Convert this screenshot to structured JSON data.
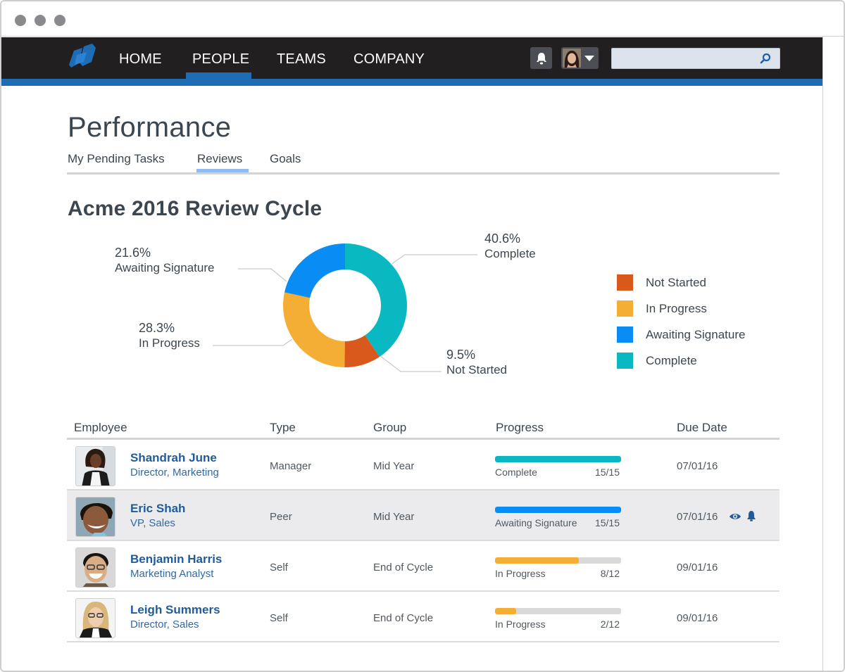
{
  "window": {
    "controls": [
      "close",
      "minimize",
      "maximize"
    ]
  },
  "navbar": {
    "logo": "company-logo",
    "items": [
      {
        "label": "HOME",
        "active": false
      },
      {
        "label": "PEOPLE",
        "active": true
      },
      {
        "label": "TEAMS",
        "active": false
      },
      {
        "label": "COMPANY",
        "active": false
      }
    ],
    "notifications_icon": "bell-icon",
    "user_menu_icon": "chevron-down-icon",
    "search": {
      "value": "",
      "placeholder": "",
      "icon": "search-icon"
    }
  },
  "page": {
    "title": "Performance",
    "tabs": [
      {
        "label": "My Pending Tasks",
        "active": false
      },
      {
        "label": "Reviews",
        "active": true
      },
      {
        "label": "Goals",
        "active": false
      }
    ],
    "section_title": "Acme 2016 Review Cycle"
  },
  "colors": {
    "not_started": "#d9581c",
    "in_progress": "#f5ae35",
    "awaiting_signature": "#0a8cf5",
    "complete": "#0ab8c2",
    "nav_bg": "#221f20",
    "brand_blue": "#1e6db4",
    "link": "#1f5c99"
  },
  "chart_data": {
    "type": "pie",
    "variant": "donut",
    "title": "Acme 2016 Review Cycle",
    "categories": [
      "Complete",
      "Not Started",
      "In Progress",
      "Awaiting Signature"
    ],
    "values": [
      40.6,
      9.5,
      28.3,
      21.6
    ],
    "unit": "%",
    "data_labels": [
      "40.6%",
      "9.5%",
      "28.3%",
      "21.6%"
    ],
    "colors": [
      "#0ab8c2",
      "#d9581c",
      "#f5ae35",
      "#0a8cf5"
    ],
    "start_angle": "12 o'clock",
    "direction": "clockwise",
    "legend": {
      "placement": "right",
      "entries": [
        {
          "label": "Not Started",
          "color": "#d9581c"
        },
        {
          "label": "In Progress",
          "color": "#f5ae35"
        },
        {
          "label": "Awaiting Signature",
          "color": "#0a8cf5"
        },
        {
          "label": "Complete",
          "color": "#0ab8c2"
        }
      ]
    }
  },
  "table": {
    "columns": [
      "Employee",
      "Type",
      "Group",
      "Progress",
      "Due Date"
    ],
    "rows": [
      {
        "name": "Shandrah June",
        "title": "Director, Marketing",
        "type": "Manager",
        "group": "Mid Year",
        "status": "Complete",
        "done": 15,
        "total": 15,
        "count": "15/15",
        "due": "07/01/16",
        "bar_color": "#0ab8c2",
        "highlight": false,
        "actions": []
      },
      {
        "name": "Eric Shah",
        "title": "VP, Sales",
        "type": "Peer",
        "group": "Mid Year",
        "status": "Awaiting Signature",
        "done": 15,
        "total": 15,
        "count": "15/15",
        "due": "07/01/16",
        "bar_color": "#0a8cf5",
        "highlight": true,
        "actions": [
          "eye-icon",
          "bell-icon"
        ]
      },
      {
        "name": "Benjamin Harris",
        "title": "Marketing Analyst",
        "type": "Self",
        "group": "End of Cycle",
        "status": "In Progress",
        "done": 8,
        "total": 12,
        "count": "8/12",
        "due": "09/01/16",
        "bar_color": "#f5ae35",
        "highlight": false,
        "actions": []
      },
      {
        "name": "Leigh Summers",
        "title": "Director, Sales",
        "type": "Self",
        "group": "End of Cycle",
        "status": "In Progress",
        "done": 2,
        "total": 12,
        "count": "2/12",
        "due": "09/01/16",
        "bar_color": "#f5ae35",
        "highlight": false,
        "actions": []
      }
    ]
  }
}
